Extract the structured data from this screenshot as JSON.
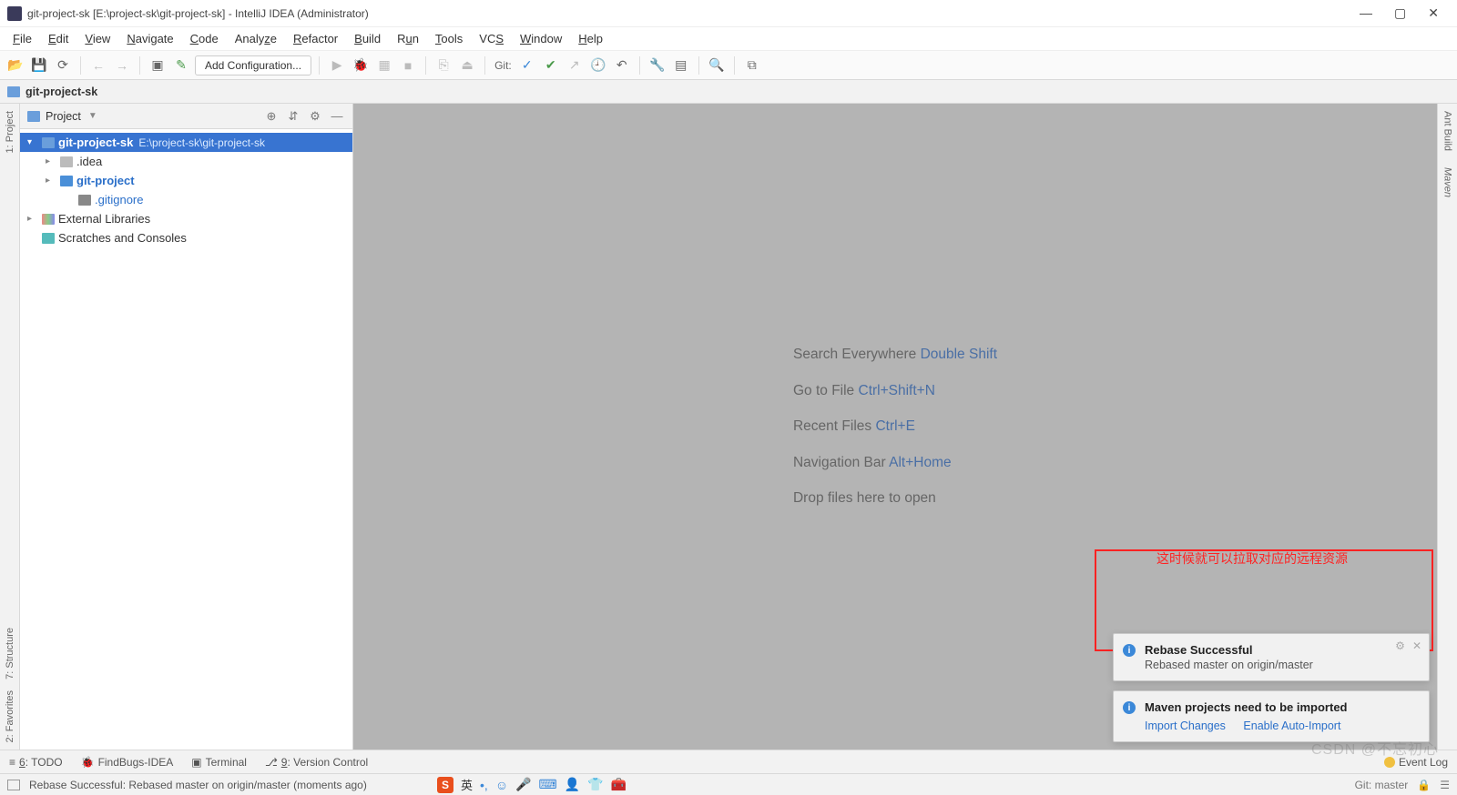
{
  "titlebar": {
    "text": "git-project-sk [E:\\project-sk\\git-project-sk] - IntelliJ IDEA (Administrator)"
  },
  "menu": [
    "File",
    "Edit",
    "View",
    "Navigate",
    "Code",
    "Analyze",
    "Refactor",
    "Build",
    "Run",
    "Tools",
    "VCS",
    "Window",
    "Help"
  ],
  "toolbar": {
    "config_label": "Add Configuration...",
    "git_label": "Git:"
  },
  "breadcrumb": {
    "root": "git-project-sk"
  },
  "sidebar": {
    "header": "Project",
    "tree": {
      "root_name": "git-project-sk",
      "root_path": "E:\\project-sk\\git-project-sk",
      "idea": ".idea",
      "gitproject": "git-project",
      "gitignore": ".gitignore",
      "ext_lib": "External Libraries",
      "scratch": "Scratches and Consoles"
    }
  },
  "left_tools": {
    "project": "1: Project",
    "structure": "7: Structure",
    "favorites": "2: Favorites"
  },
  "right_tools": {
    "ant": "Ant Build",
    "maven": "Maven"
  },
  "editor_hints": {
    "l1t": "Search Everywhere",
    "l1k": "Double Shift",
    "l2t": "Go to File",
    "l2k": "Ctrl+Shift+N",
    "l3t": "Recent Files",
    "l3k": "Ctrl+E",
    "l4t": "Navigation Bar",
    "l4k": "Alt+Home",
    "l5t": "Drop files here to open"
  },
  "red_caption": "这时候就可以拉取对应的远程资源",
  "notifications": {
    "rebase": {
      "title": "Rebase Successful",
      "text": "Rebased master on origin/master"
    },
    "maven": {
      "title": "Maven projects need to be imported",
      "link1": "Import Changes",
      "link2": "Enable Auto-Import"
    }
  },
  "bottom_tools": {
    "todo": "6: TODO",
    "findbugs": "FindBugs-IDEA",
    "terminal": "Terminal",
    "version": "9: Version Control",
    "eventlog": "Event Log"
  },
  "statusbar": {
    "msg": "Rebase Successful: Rebased master on origin/master (moments ago)",
    "branch": "Git: master"
  },
  "ime": {
    "lang": "英"
  },
  "watermark": "CSDN @不忘初心"
}
